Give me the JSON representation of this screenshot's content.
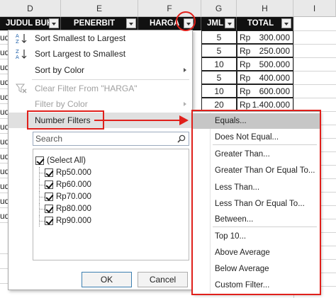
{
  "columns": [
    {
      "letter": "D"
    },
    {
      "letter": "E"
    },
    {
      "letter": "F"
    },
    {
      "letter": "G"
    },
    {
      "letter": "H"
    },
    {
      "letter": "I"
    }
  ],
  "table_header": {
    "judul": "JUDUL BUKU",
    "penerbit": "PENERBIT",
    "harga": "HARGA",
    "jml": "JML",
    "total": "TOTAL"
  },
  "row_fragment": "udul",
  "rows": [
    {
      "jml": "5",
      "currency": "Rp",
      "total": "300.000"
    },
    {
      "jml": "5",
      "currency": "Rp",
      "total": "250.000"
    },
    {
      "jml": "10",
      "currency": "Rp",
      "total": "500.000"
    },
    {
      "jml": "5",
      "currency": "Rp",
      "total": "400.000"
    },
    {
      "jml": "10",
      "currency": "Rp",
      "total": "600.000"
    },
    {
      "jml": "20",
      "currency": "Rp",
      "total": "1.400.000"
    }
  ],
  "menu": {
    "sort_asc": "Sort Smallest to Largest",
    "sort_desc": "Sort Largest to Smallest",
    "sort_color": "Sort by Color",
    "clear_filter": "Clear Filter From \"HARGA\"",
    "filter_color": "Filter by Color",
    "number_filters": "Number Filters",
    "search_placeholder": "Search",
    "values": [
      "(Select All)",
      "Rp50.000",
      "Rp60.000",
      "Rp70.000",
      "Rp80.000",
      "Rp90.000"
    ],
    "ok": "OK",
    "cancel": "Cancel"
  },
  "submenu": {
    "items": [
      "Equals...",
      "Does Not Equal...",
      "Greater Than...",
      "Greater Than Or Equal To...",
      "Less Than...",
      "Less Than Or Equal To...",
      "Between...",
      "Top 10...",
      "Above Average",
      "Below Average",
      "Custom Filter..."
    ]
  },
  "colors": {
    "annotation": "#e0201b",
    "header_bg": "#111111",
    "hover": "#c6c6c6"
  }
}
